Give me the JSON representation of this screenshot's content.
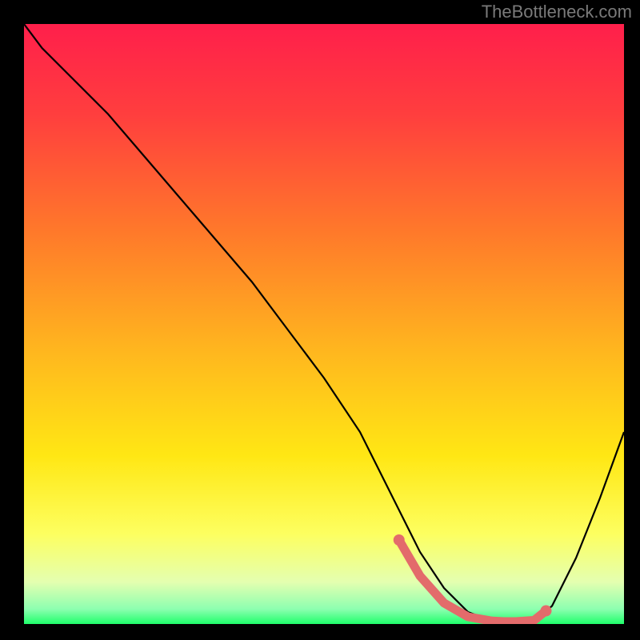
{
  "watermark": "TheBottleneck.com",
  "chart_data": {
    "type": "line",
    "title": "",
    "xlabel": "",
    "ylabel": "",
    "xlim": [
      0,
      100
    ],
    "ylim": [
      0,
      100
    ],
    "grid": false,
    "curve": {
      "x": [
        0,
        3,
        8,
        14,
        20,
        26,
        32,
        38,
        44,
        50,
        56,
        60,
        63,
        66,
        70,
        74,
        78,
        80,
        82,
        85,
        88,
        92,
        96,
        100
      ],
      "y": [
        100,
        96,
        91,
        85,
        78,
        71,
        64,
        57,
        49,
        41,
        32,
        24,
        18,
        12,
        6,
        2,
        0.5,
        0.3,
        0.3,
        0.5,
        3,
        11,
        21,
        32
      ]
    },
    "highlight_segment": {
      "x": [
        62.5,
        66,
        70,
        74,
        78,
        80,
        82,
        85,
        87
      ],
      "y": [
        14,
        8,
        3.5,
        1.2,
        0.5,
        0.4,
        0.4,
        0.6,
        2.2
      ]
    },
    "gradient_stops": [
      {
        "offset": 0.0,
        "color": "#ff1f4b"
      },
      {
        "offset": 0.15,
        "color": "#ff3e3e"
      },
      {
        "offset": 0.35,
        "color": "#ff7a2a"
      },
      {
        "offset": 0.55,
        "color": "#ffb81e"
      },
      {
        "offset": 0.72,
        "color": "#ffe714"
      },
      {
        "offset": 0.85,
        "color": "#fdff60"
      },
      {
        "offset": 0.93,
        "color": "#e4ffb0"
      },
      {
        "offset": 0.975,
        "color": "#8dffb0"
      },
      {
        "offset": 1.0,
        "color": "#1fff6b"
      }
    ]
  }
}
